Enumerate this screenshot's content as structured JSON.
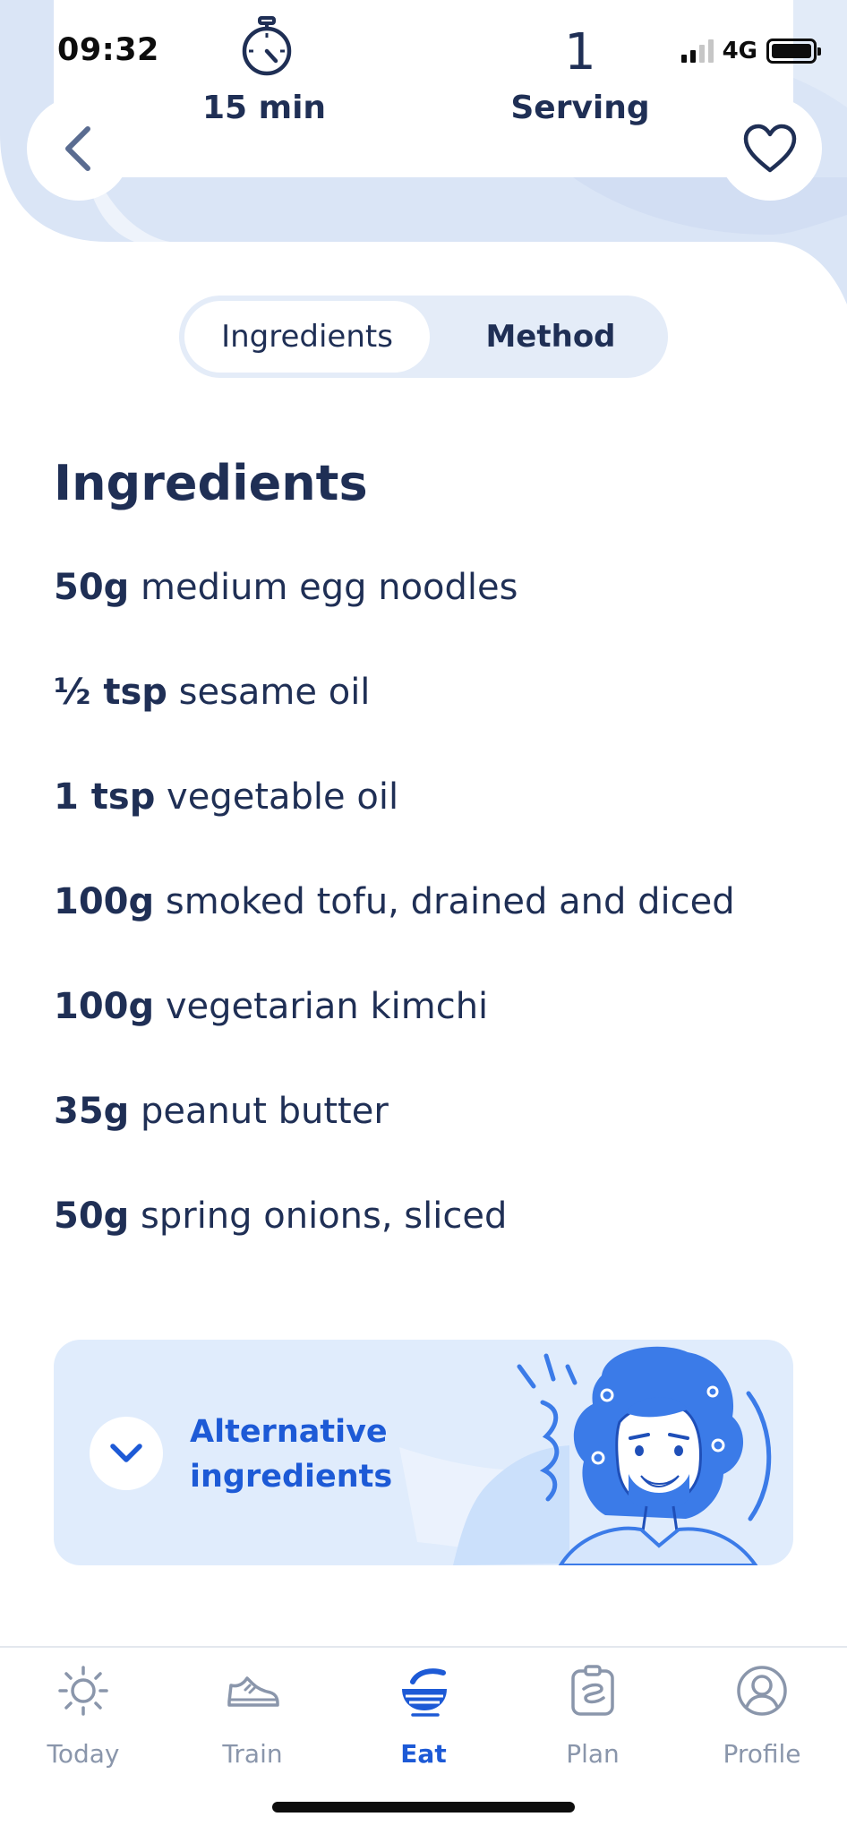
{
  "status_bar": {
    "time": "09:32",
    "network": "4G",
    "signal_bars_on": 2,
    "signal_bars_total": 4
  },
  "recipe_meta": {
    "time_label": "15 min",
    "servings_count": "1",
    "servings_label": "Serving"
  },
  "tabs": {
    "ingredients_label": "Ingredients",
    "method_label": "Method",
    "active": "ingredients"
  },
  "ingredients": {
    "title": "Ingredients",
    "items": [
      {
        "qty": "50g",
        "name": "medium egg noodles"
      },
      {
        "qty": "½ tsp",
        "name": "sesame oil"
      },
      {
        "qty": "1 tsp",
        "name": "vegetable oil"
      },
      {
        "qty": "100g",
        "name": "smoked tofu, drained and diced"
      },
      {
        "qty": "100g",
        "name": "vegetarian kimchi"
      },
      {
        "qty": "35g",
        "name": "peanut butter"
      },
      {
        "qty": "50g",
        "name": "spring onions, sliced"
      }
    ]
  },
  "alternative": {
    "line1": "Alternative",
    "line2": "ingredients",
    "toggle_icon": "chevron-down-icon"
  },
  "nav": {
    "items": [
      {
        "label": "Today",
        "icon": "sun-icon",
        "active": false
      },
      {
        "label": "Train",
        "icon": "shoe-icon",
        "active": false
      },
      {
        "label": "Eat",
        "icon": "bowl-icon",
        "active": true
      },
      {
        "label": "Plan",
        "icon": "clipboard-icon",
        "active": false
      },
      {
        "label": "Profile",
        "icon": "profile-icon",
        "active": false
      }
    ]
  },
  "colors": {
    "text_primary": "#1f2f55",
    "accent": "#1d5ad6",
    "header_bg": "#dae5f6",
    "card_bg": "#e0ecfc",
    "nav_inactive": "#8a96ab"
  }
}
